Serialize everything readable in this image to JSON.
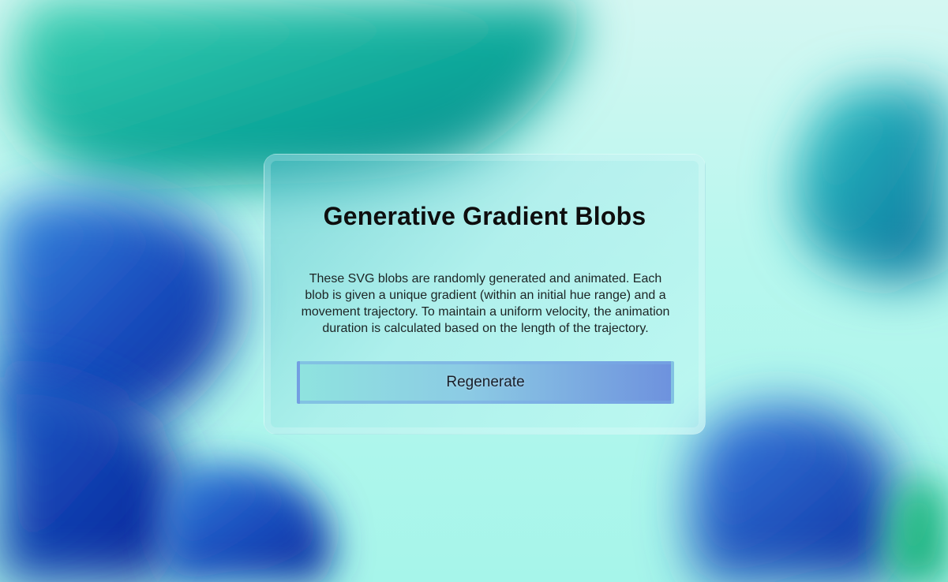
{
  "page": {
    "title": "Generative Gradient Blobs",
    "description": "These SVG blobs are randomly generated and animated. Each blob is given a unique gradient (within an initial hue range) and a movement trajectory. To maintain a uniform velocity, the animation duration is calculated based on the length of the trajectory.",
    "regenerate_label": "Regenerate"
  },
  "colors": {
    "background_light": "#b7f7ee",
    "teal": "#1fb5a8",
    "deep_teal": "#078a8e",
    "blue": "#2a6fd0",
    "deep_blue": "#0a2a9e",
    "green": "#27c191",
    "button_start": "#8fe3df",
    "button_end": "#6e92de"
  }
}
